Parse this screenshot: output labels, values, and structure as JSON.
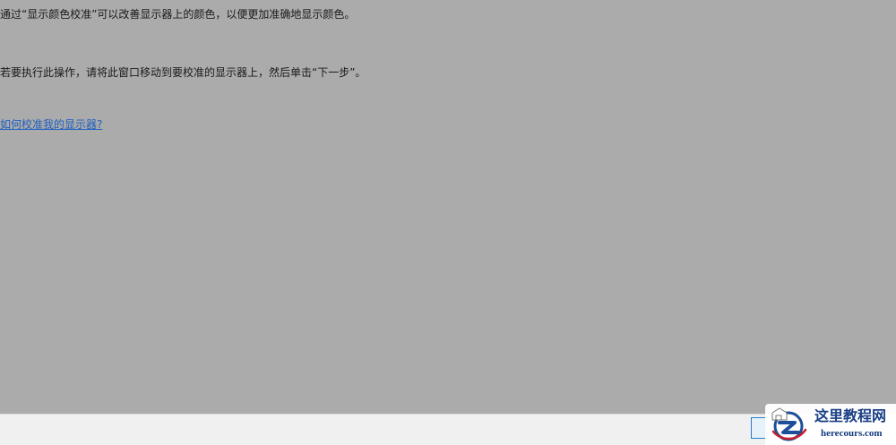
{
  "content": {
    "intro_text": "通过“显示颜色校准”可以改善显示器上的颜色，以便更加准确地显示颜色。",
    "instruction_text": "若要执行此操作，请将此窗口移动到要校准的显示器上，然后单击“下一步”。",
    "help_link": "如何校准我的显示器?"
  },
  "watermark": {
    "logo_icon": "z-logo-icon",
    "title": "这里教程网",
    "url": "herecours.com"
  },
  "colors": {
    "background": "#ababab",
    "link": "#1f5fbf",
    "footer": "#f0f0f0",
    "watermark_text": "#1a3f86"
  }
}
